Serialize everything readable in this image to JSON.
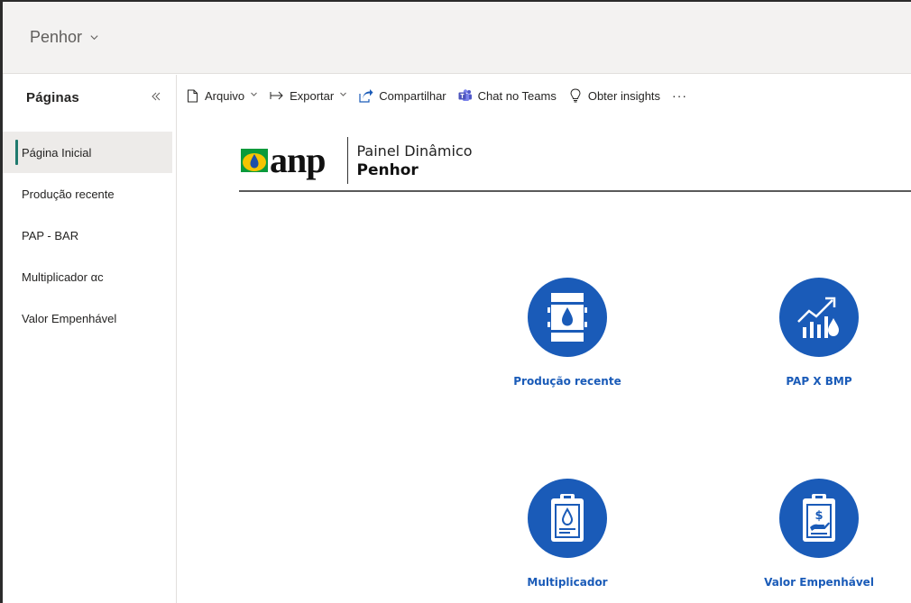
{
  "workspace": {
    "title": "Penhor"
  },
  "sidebar": {
    "title": "Páginas",
    "items": [
      {
        "label": "Página Inicial"
      },
      {
        "label": "Produção recente"
      },
      {
        "label": "PAP - BAR"
      },
      {
        "label": "Multiplicador αc"
      },
      {
        "label": "Valor Empenhável"
      }
    ]
  },
  "toolbar": {
    "file_label": "Arquivo",
    "export_label": "Exportar",
    "share_label": "Compartilhar",
    "teams_label": "Chat no Teams",
    "insights_label": "Obter insights",
    "more_label": "···"
  },
  "report": {
    "logo_text": "anp",
    "header_line1": "Painel Dinâmico",
    "header_line2": "Penhor",
    "cards": [
      {
        "label": "Produção recente",
        "icon": "oil-barrel-icon"
      },
      {
        "label": "PAP X BMP",
        "icon": "growth-chart-drop-icon"
      },
      {
        "label": "Multiplicador",
        "icon": "clipboard-drop-icon"
      },
      {
        "label": "Valor Empenhável",
        "icon": "clipboard-money-icon"
      }
    ]
  },
  "colors": {
    "accent": "#1a5bb8",
    "active_indicator": "#1f7a6e"
  }
}
